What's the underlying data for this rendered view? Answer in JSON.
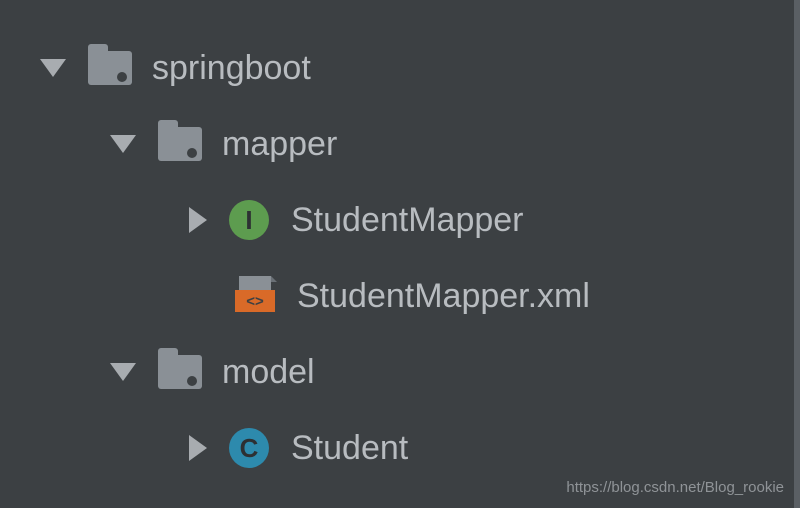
{
  "tree": {
    "root": {
      "label": "springboot",
      "children": [
        {
          "label": "mapper",
          "children": [
            {
              "label": "StudentMapper",
              "icon": "interface"
            },
            {
              "label": "StudentMapper.xml",
              "icon": "xml"
            }
          ]
        },
        {
          "label": "model",
          "children": [
            {
              "label": "Student",
              "icon": "class"
            }
          ]
        }
      ]
    }
  },
  "icons": {
    "interface_letter": "I",
    "class_letter": "C",
    "xml_brackets": "<>"
  },
  "watermark": "https://blog.csdn.net/Blog_rookie"
}
